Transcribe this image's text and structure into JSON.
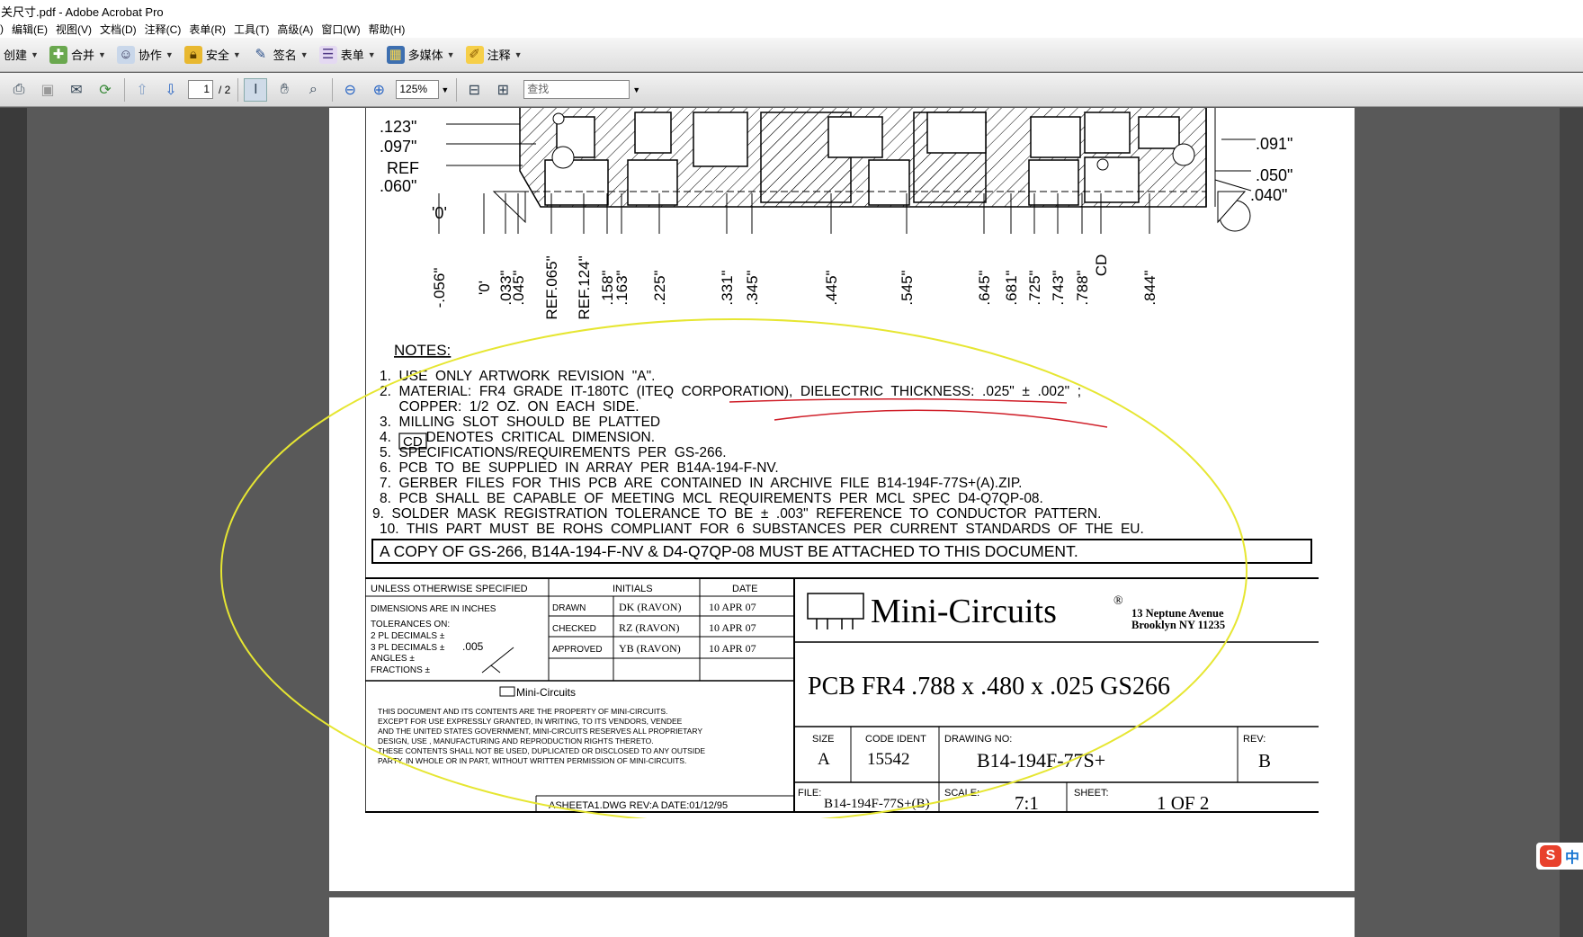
{
  "window": {
    "title": "关尺寸.pdf - Adobe Acrobat Pro"
  },
  "menu": [
    "文件(F)",
    "编辑(E)",
    "视图(V)",
    "文档(D)",
    "注释(C)",
    "表单(R)",
    "工具(T)",
    "高级(A)",
    "窗口(W)",
    "帮助(H)"
  ],
  "menu_visible": [
    ")",
    "编辑(E)",
    "视图(V)",
    "文档(D)",
    "注释(C)",
    "表单(R)",
    "工具(T)",
    "高级(A)",
    "窗口(W)",
    "帮助(H)"
  ],
  "toolbar": {
    "create": "创建",
    "combine": "合并",
    "collaborate": "协作",
    "secure": "安全",
    "sign": "签名",
    "forms": "表单",
    "multimedia": "多媒体",
    "comment": "注释"
  },
  "nav": {
    "page": "1",
    "total": "/ 2",
    "zoom": "125%",
    "find_placeholder": "查找"
  },
  "drawing": {
    "left_dims": [
      ".123\"",
      ".097\"",
      "REF",
      ".060\"",
      "'0'"
    ],
    "right_dims": [
      ".091\"",
      ".050\"",
      ".040\""
    ],
    "bottom_dims": [
      "-.056\"",
      "'0'",
      ".033\"",
      ".045\"",
      "REF.065\"",
      "REF.124\"",
      ".158\"",
      ".163\"",
      ".225\"",
      ".331\"",
      ".345\"",
      ".445\"",
      ".545\"",
      ".645\"",
      ".681\"",
      ".725\"",
      ".743\"",
      ".788\"",
      "CD",
      ".844\""
    ],
    "notes_title": "NOTES:",
    "notes": [
      "1.  USE  ONLY  ARTWORK  REVISION  \"A\".",
      "2.  MATERIAL:  FR4  GRADE  IT-180TC  (ITEQ  CORPORATION),  DIELECTRIC  THICKNESS:  .025\"  ±  .002\"  ;",
      "     COPPER:  1/2  OZ.  ON  EACH  SIDE.",
      "3.  MILLING  SLOT  SHOULD  BE  PLATTED",
      "4.         DENOTES  CRITICAL  DIMENSION.",
      "5.  SPECIFICATIONS/REQUIREMENTS  PER  GS-266.",
      "6.  PCB  TO  BE  SUPPLIED  IN  ARRAY  PER  B14A-194-F-NV.",
      "7.  GERBER  FILES  FOR  THIS  PCB  ARE  CONTAINED  IN  ARCHIVE  FILE  B14-194F-77S+(A).ZIP.",
      "8.  PCB  SHALL  BE  CAPABLE  OF  MEETING  MCL  REQUIREMENTS  PER  MCL  SPEC  D4-Q7QP-08.",
      "9.  SOLDER  MASK  REGISTRATION  TOLERANCE  TO  BE  ±  .003\"  REFERENCE  TO  CONDUCTOR  PATTERN.",
      "10.  THIS  PART  MUST  BE  ROHS  COMPLIANT  FOR  6  SUBSTANCES  PER  CURRENT  STANDARDS  OF  THE  EU."
    ],
    "cd_box": "CD",
    "attach_note": "A  COPY  OF  GS-266,  B14A-194-F-NV  &  D4-Q7QP-08  MUST  BE  ATTACHED  TO  THIS  DOCUMENT.",
    "title_block": {
      "unless": "UNLESS  OTHERWISE  SPECIFIED",
      "initials": "INITIALS",
      "date": "DATE",
      "dims_in": "DIMENSIONS  ARE  IN  INCHES",
      "tol_on": "TOLERANCES  ON:",
      "pl2": "2  PL  DECIMALS  ±",
      "pl3": "3  PL  DECIMALS  ±",
      "pl3_val": ".005",
      "angles": "ANGLES  ±",
      "fractions": "FRACTIONS  ±",
      "drawn": "DRAWN",
      "drawn_by": "DK  (RAVON)",
      "drawn_date": "10  APR  07",
      "checked": "CHECKED",
      "checked_by": "RZ  (RAVON)",
      "checked_date": "10  APR  07",
      "approved": "APPROVED",
      "approved_by": "YB  (RAVON)",
      "approved_date": "10  APR  07",
      "mc_small": "Mini-Circuits",
      "prop1": "THIS DOCUMENT AND ITS CONTENTS ARE THE PROPERTY OF MINI-CIRCUITS.",
      "prop2": "EXCEPT FOR USE EXPRESSLY GRANTED, IN WRITING, TO ITS VENDORS, VENDEE",
      "prop3": "AND THE UNITED STATES GOVERNMENT, MINI-CIRCUITS  RESERVES ALL PROPRIETARY",
      "prop4": "DESIGN, USE , MANUFACTURING AND REPRODUCTION RIGHTS THERETO.",
      "prop5": "THESE CONTENTS SHALL NOT BE USED, DUPLICATED OR DISCLOSED TO ANY OUTSIDE",
      "prop6": "PARTY, IN WHOLE OR IN PART, WITHOUT WRITTEN PERMISSION OF MINI-CIRCUITS.",
      "asheet": "ASHEETA1.DWG  REV:A    DATE:01/12/95",
      "brand": "Mini-Circuits",
      "addr1": "13  Neptune  Avenue",
      "addr2": "Brooklyn  NY  11235",
      "desc": "PCB  FR4  .788  x  .480  x  .025  GS266",
      "size_lbl": "SIZE",
      "size": "A",
      "code_lbl": "CODE  IDENT",
      "code": "15542",
      "dwg_lbl": "DRAWING  NO:",
      "dwg": "B14-194F-77S+",
      "rev_lbl": "REV:",
      "rev": "B",
      "file_lbl": "FILE:",
      "file": "B14-194F-77S+(B)",
      "scale_lbl": "SCALE:",
      "scale": "7:1",
      "sheet_lbl": "SHEET:",
      "sheet": "1  OF  2"
    }
  },
  "ime": {
    "label": "中"
  },
  "colors": {
    "annotation_red": "#d0202a",
    "annotation_yellow": "#e6e632",
    "page_bg": "#595959"
  }
}
